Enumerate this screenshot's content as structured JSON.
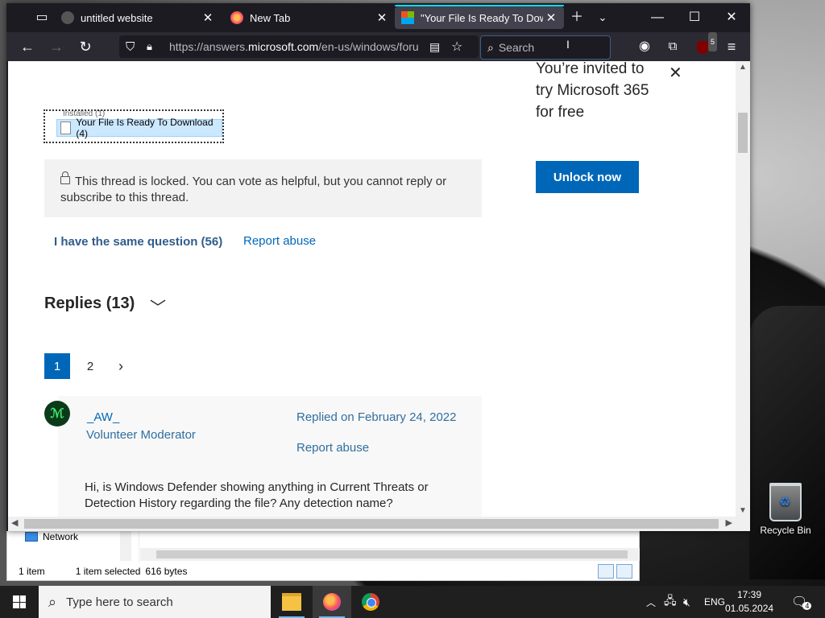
{
  "browser": {
    "tabs": [
      {
        "label": "untitled website",
        "active": false
      },
      {
        "label": "New Tab",
        "active": false
      },
      {
        "label": "\"Your File Is Ready To Downlo",
        "active": true
      }
    ],
    "url_prefix": "https://answers.",
    "url_domain": "microsoft.com",
    "url_suffix": "/en-us/windows/foru",
    "search_placeholder": "Search",
    "ublock_badge": "5"
  },
  "page": {
    "download_item_label": "Your File Is Ready To Download (4)",
    "download_item_cut": "Installed (1)",
    "locked_message": "This thread is locked. You can vote as helpful, but you cannot reply or subscribe to this thread.",
    "same_question": "I have the same question (56)",
    "report_abuse": "Report abuse",
    "replies_heading": "Replies (13)",
    "pages": [
      "1",
      "2"
    ],
    "reply": {
      "avatar_text": "ℳ",
      "username": "_AW_",
      "role": "Volunteer Moderator",
      "replied_on": "Replied on February 24, 2022",
      "report_abuse": "Report abuse",
      "body": "Hi, is Windows Defender showing anything in Current Threats or Detection History regarding the file? Any detection name?"
    },
    "ad": {
      "text": "You’re invited to try Microsoft 365 for free",
      "button": "Unlock now"
    }
  },
  "explorer": {
    "nav_item": "Network",
    "status_count": "1 item",
    "status_selected": "1 item selected",
    "status_size": "616 bytes"
  },
  "desktop": {
    "recycle_bin": "Recycle Bin"
  },
  "taskbar": {
    "search_placeholder": "Type here to search",
    "language": "ENG",
    "time": "17:39",
    "date": "01.05.2024",
    "notification_count": "4"
  }
}
